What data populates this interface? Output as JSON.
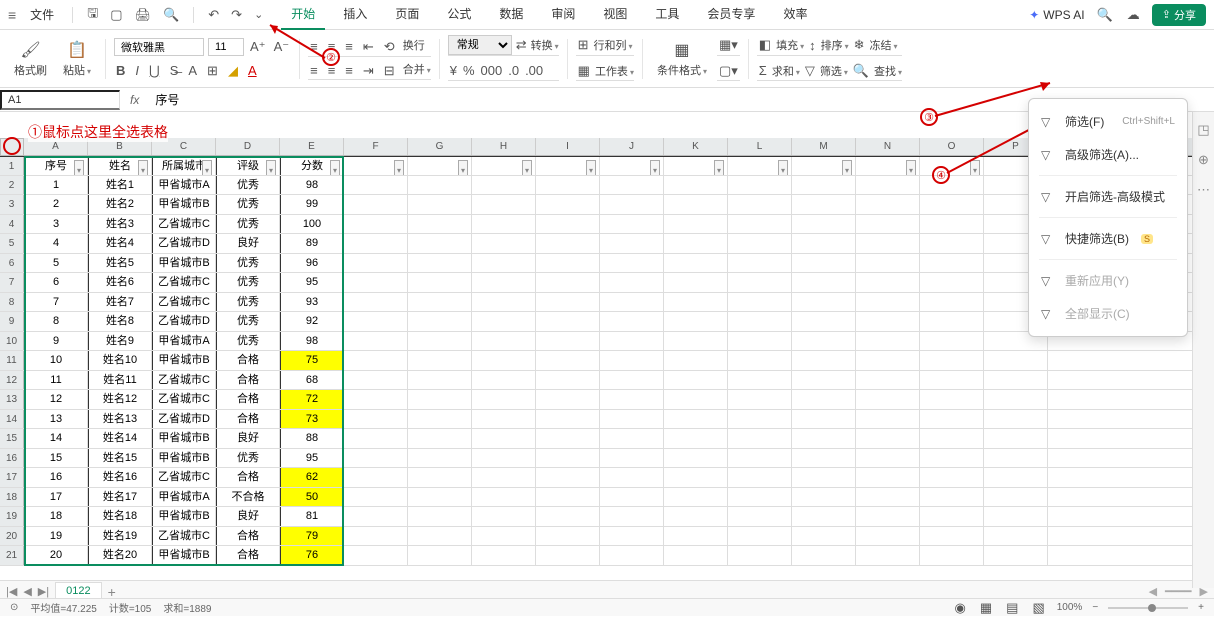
{
  "menu": {
    "file": "文件",
    "tabs": [
      "开始",
      "插入",
      "页面",
      "公式",
      "数据",
      "审阅",
      "视图",
      "工具",
      "会员专享",
      "效率"
    ],
    "wps_ai": "WPS AI",
    "share": "分享"
  },
  "ribbon": {
    "format_painter": "格式刷",
    "paste": "粘贴",
    "font_name": "微软雅黑",
    "font_size": "11",
    "number_format": "常规",
    "convert": "转换",
    "wrap": "换行",
    "merge": "合并",
    "rowcol": "行和列",
    "worksheet": "工作表",
    "cond_fmt": "条件格式",
    "freeze": "冻结",
    "fill": "填充",
    "sort": "排序",
    "sum": "求和",
    "filter": "筛选",
    "find": "查找"
  },
  "fbar": {
    "name": "A1",
    "value": "序号"
  },
  "anno": {
    "text": "①鼠标点这里全选表格",
    "n2": "②",
    "n3": "③",
    "n4": "④"
  },
  "table": {
    "cols": [
      "A",
      "B",
      "C",
      "D",
      "E",
      "F",
      "G",
      "H",
      "I",
      "J",
      "K",
      "L",
      "M",
      "N",
      "O",
      "P"
    ],
    "headers": [
      "序号",
      "姓名",
      "所属城市",
      "评级",
      "分数"
    ],
    "rows": [
      {
        "r": 1,
        "n": "1",
        "name": "姓名1",
        "city": "甲省城市A",
        "grade": "优秀",
        "score": "98",
        "hl": false
      },
      {
        "r": 2,
        "n": "2",
        "name": "姓名2",
        "city": "甲省城市B",
        "grade": "优秀",
        "score": "99",
        "hl": false
      },
      {
        "r": 3,
        "n": "3",
        "name": "姓名3",
        "city": "乙省城市C",
        "grade": "优秀",
        "score": "100",
        "hl": false
      },
      {
        "r": 4,
        "n": "4",
        "name": "姓名4",
        "city": "乙省城市D",
        "grade": "良好",
        "score": "89",
        "hl": false
      },
      {
        "r": 5,
        "n": "5",
        "name": "姓名5",
        "city": "甲省城市B",
        "grade": "优秀",
        "score": "96",
        "hl": false
      },
      {
        "r": 6,
        "n": "6",
        "name": "姓名6",
        "city": "乙省城市C",
        "grade": "优秀",
        "score": "95",
        "hl": false
      },
      {
        "r": 7,
        "n": "7",
        "name": "姓名7",
        "city": "乙省城市C",
        "grade": "优秀",
        "score": "93",
        "hl": false
      },
      {
        "r": 8,
        "n": "8",
        "name": "姓名8",
        "city": "乙省城市D",
        "grade": "优秀",
        "score": "92",
        "hl": false
      },
      {
        "r": 9,
        "n": "9",
        "name": "姓名9",
        "city": "甲省城市A",
        "grade": "优秀",
        "score": "98",
        "hl": false
      },
      {
        "r": 10,
        "n": "10",
        "name": "姓名10",
        "city": "甲省城市B",
        "grade": "合格",
        "score": "75",
        "hl": true
      },
      {
        "r": 11,
        "n": "11",
        "name": "姓名11",
        "city": "乙省城市C",
        "grade": "合格",
        "score": "68",
        "hl": false
      },
      {
        "r": 12,
        "n": "12",
        "name": "姓名12",
        "city": "乙省城市C",
        "grade": "合格",
        "score": "72",
        "hl": true
      },
      {
        "r": 13,
        "n": "13",
        "name": "姓名13",
        "city": "乙省城市D",
        "grade": "合格",
        "score": "73",
        "hl": true
      },
      {
        "r": 14,
        "n": "14",
        "name": "姓名14",
        "city": "甲省城市B",
        "grade": "良好",
        "score": "88",
        "hl": false
      },
      {
        "r": 15,
        "n": "15",
        "name": "姓名15",
        "city": "甲省城市B",
        "grade": "优秀",
        "score": "95",
        "hl": false
      },
      {
        "r": 16,
        "n": "16",
        "name": "姓名16",
        "city": "乙省城市C",
        "grade": "合格",
        "score": "62",
        "hl": true
      },
      {
        "r": 17,
        "n": "17",
        "name": "姓名17",
        "city": "甲省城市A",
        "grade": "不合格",
        "score": "50",
        "hl": true
      },
      {
        "r": 18,
        "n": "18",
        "name": "姓名18",
        "city": "甲省城市B",
        "grade": "良好",
        "score": "81",
        "hl": false
      },
      {
        "r": 19,
        "n": "19",
        "name": "姓名19",
        "city": "乙省城市C",
        "grade": "合格",
        "score": "79",
        "hl": true
      },
      {
        "r": 20,
        "n": "20",
        "name": "姓名20",
        "city": "甲省城市B",
        "grade": "合格",
        "score": "76",
        "hl": true
      }
    ]
  },
  "filter_dd": {
    "filter": "筛选(F)",
    "filter_sc": "Ctrl+Shift+L",
    "adv": "高级筛选(A)...",
    "premium": "开启筛选-高级模式",
    "quick": "快捷筛选(B)",
    "reapply": "重新应用(Y)",
    "showall": "全部显示(C)"
  },
  "sheet": {
    "name": "0122"
  },
  "status": {
    "avg": "平均值=47.225",
    "count": "计数=105",
    "sum": "求和=1889",
    "zoom": "100%"
  }
}
